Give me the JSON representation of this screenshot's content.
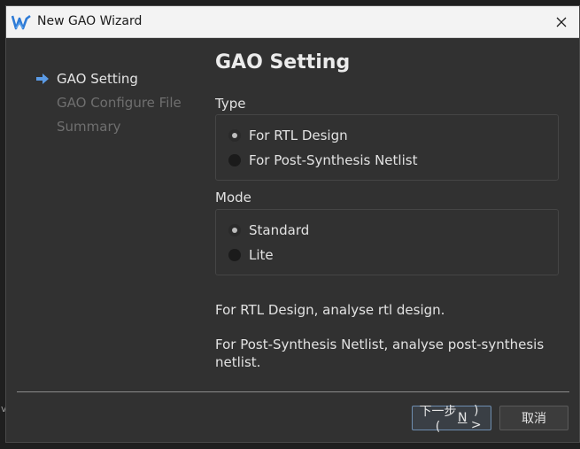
{
  "window": {
    "title": "New GAO Wizard",
    "accent": "#2e7bd6"
  },
  "nav": {
    "items": [
      {
        "label": "GAO Setting",
        "active": true
      },
      {
        "label": "GAO Configure File",
        "active": false
      },
      {
        "label": "Summary",
        "active": false
      }
    ]
  },
  "page": {
    "heading": "GAO Setting",
    "type": {
      "label": "Type",
      "options": [
        "For RTL Design",
        "For Post-Synthesis Netlist"
      ],
      "selected": "For RTL Design"
    },
    "mode": {
      "label": "Mode",
      "options": [
        "Standard",
        "Lite"
      ],
      "selected": "Standard"
    },
    "description": {
      "line1": "For RTL Design, analyse rtl design.",
      "line2": "For Post-Synthesis Netlist, analyse post-synthesis netlist."
    }
  },
  "buttons": {
    "next_prefix": "下一步(",
    "next_key": "N",
    "next_suffix": ") >",
    "cancel": "取消"
  },
  "background": {
    "edge_mark": "v"
  },
  "icons": {
    "app": "gowin-logo-icon",
    "close": "close-icon",
    "nav_current": "arrow-right-icon"
  }
}
